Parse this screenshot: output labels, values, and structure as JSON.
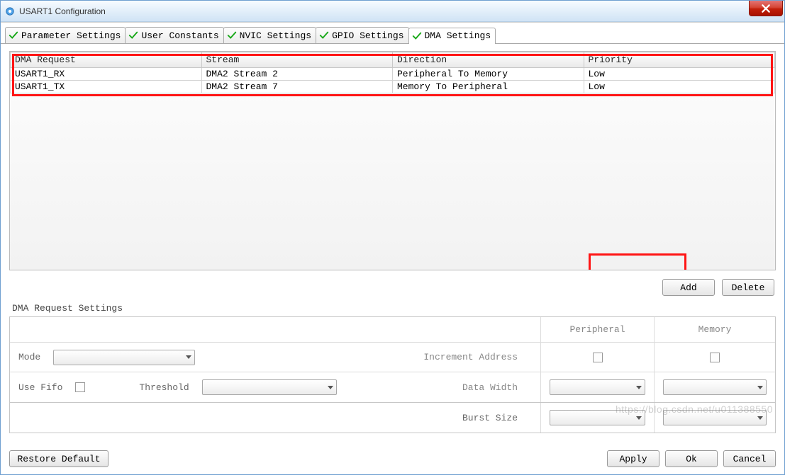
{
  "titlebar": {
    "title": "USART1 Configuration"
  },
  "tabs": [
    {
      "label": "Parameter Settings"
    },
    {
      "label": "User Constants"
    },
    {
      "label": "NVIC Settings"
    },
    {
      "label": "GPIO Settings"
    },
    {
      "label": "DMA Settings"
    }
  ],
  "table": {
    "headers": {
      "req": "DMA Request",
      "stream": "Stream",
      "dir": "Direction",
      "prio": "Priority"
    },
    "rows": [
      {
        "req": "USART1_RX",
        "stream": "DMA2 Stream 2",
        "dir": "Peripheral To Memory",
        "prio": "Low"
      },
      {
        "req": "USART1_TX",
        "stream": "DMA2 Stream 7",
        "dir": "Memory To Peripheral",
        "prio": "Low"
      }
    ]
  },
  "buttons": {
    "add": "Add",
    "delete": "Delete",
    "restore": "Restore Default",
    "apply": "Apply",
    "ok": "Ok",
    "cancel": "Cancel"
  },
  "settings": {
    "groupLabel": "DMA Request Settings",
    "peripheral": "Peripheral",
    "memory": "Memory",
    "mode": "Mode",
    "incAddr": "Increment Address",
    "useFifo": "Use Fifo",
    "threshold": "Threshold",
    "dataWidth": "Data Width",
    "burstSize": "Burst Size"
  },
  "watermark": "https://blog.csdn.net/u011388550"
}
